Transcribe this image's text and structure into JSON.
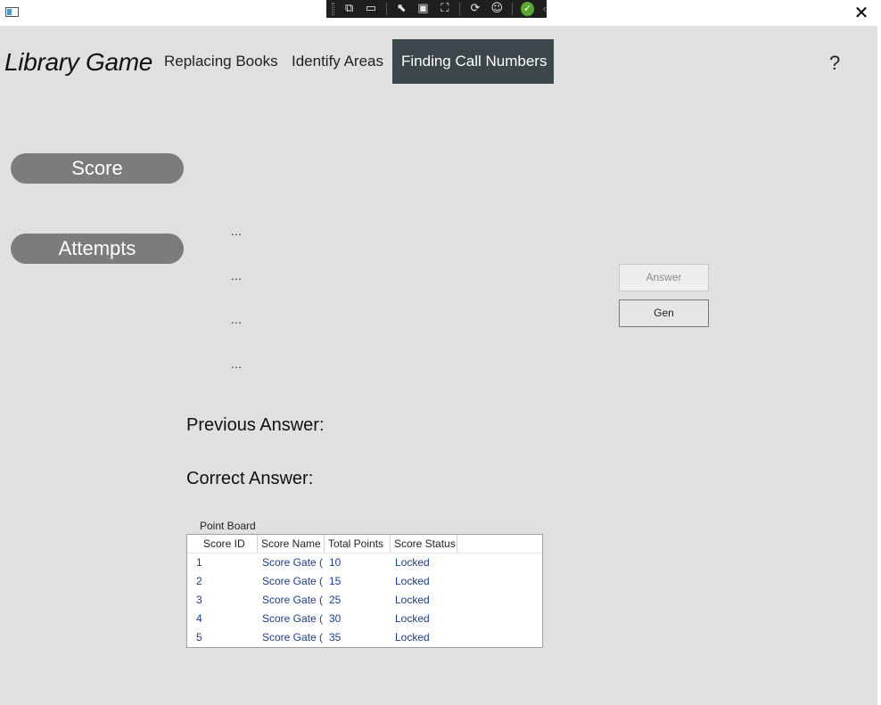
{
  "window": {
    "close_glyph": "✕"
  },
  "header": {
    "brand": "Library Game",
    "tabs": [
      {
        "label": "Replacing Books",
        "active": false
      },
      {
        "label": "Identify Areas",
        "active": false
      },
      {
        "label": "Finding Call Numbers",
        "active": true
      }
    ],
    "help_label": "?"
  },
  "stats": {
    "score_label": "Score",
    "attempts_label": "Attempts"
  },
  "items": [
    "...",
    "...",
    "...",
    "..."
  ],
  "buttons": {
    "answer_label": "Answer",
    "answer_enabled": false,
    "gen_label": "Gen"
  },
  "results": {
    "previous_answer_label": "Previous Answer:",
    "correct_answer_label": "Correct Answer:"
  },
  "point_board": {
    "title": "Point Board",
    "columns": [
      "Score ID",
      "Score Name",
      "Total Points",
      "Score Status"
    ],
    "rows": [
      {
        "id": "1",
        "name": "Score Gate (",
        "points": "10",
        "status": "Locked"
      },
      {
        "id": "2",
        "name": "Score Gate (",
        "points": "15",
        "status": "Locked"
      },
      {
        "id": "3",
        "name": "Score Gate (",
        "points": "25",
        "status": "Locked"
      },
      {
        "id": "4",
        "name": "Score Gate (",
        "points": "30",
        "status": "Locked"
      },
      {
        "id": "5",
        "name": "Score Gate (",
        "points": "35",
        "status": "Locked"
      }
    ]
  },
  "colors": {
    "active_tab_bg": "#3b474b",
    "pill_bg": "#7c7c7c",
    "grid_text": "#1d3c8f",
    "background": "#e0e0e0"
  }
}
